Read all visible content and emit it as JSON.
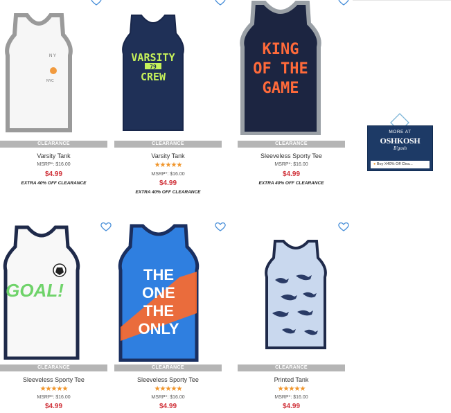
{
  "products": [
    {
      "name": "Varsity Tank",
      "badge": "CLEARANCE",
      "stars": "",
      "msrp": "MSRP*: $16.00",
      "price": "$4.99",
      "extra": "EXTRA 40% OFF CLEARANCE",
      "rating": 0,
      "shirt": {
        "body": "#f6f6f6",
        "trim": "#9a9a9a"
      }
    },
    {
      "name": "Varsity Tank",
      "badge": "CLEARANCE",
      "stars": "★★★★★",
      "msrp": "MSRP*: $16.00",
      "price": "$4.99",
      "extra": "EXTRA 40% OFF CLEARANCE",
      "rating": 5,
      "shirt": {
        "body": "#1f3057",
        "trim": "#1f3057",
        "text_lines": [
          "VARSITY",
          "79",
          "CREW"
        ],
        "text_color": "#c7f25a"
      }
    },
    {
      "name": "Sleeveless Sporty Tee",
      "badge": "CLEARANCE",
      "stars": "",
      "msrp": "MSRP*: $16.00",
      "price": "$4.99",
      "extra": "EXTRA 40% OFF CLEARANCE",
      "rating": 0,
      "shirt": {
        "body": "#1c2541",
        "trim": "#9aa0a6",
        "text_lines": [
          "KING",
          "OF THE",
          "GAME"
        ],
        "text_color": "#ff6a3a"
      }
    },
    {
      "name": "Sleeveless Sporty Tee",
      "badge": "CLEARANCE",
      "stars": "★★★★★",
      "msrp": "MSRP*: $16.00",
      "price": "$4.99",
      "extra": "",
      "rating": 5,
      "shirt": {
        "body": "#f8f8f8",
        "trim": "#1f2a4a",
        "text_lines": [
          "GOAL!"
        ],
        "text_color": "#6fd36a"
      }
    },
    {
      "name": "Sleeveless Sporty Tee",
      "badge": "CLEARANCE",
      "stars": "★★★★★",
      "msrp": "MSRP*: $16.00",
      "price": "$4.99",
      "extra": "",
      "rating": 5,
      "shirt": {
        "body": "#2f7fe0",
        "trim": "#1a2f60",
        "text_lines": [
          "THE",
          "ONE",
          "THE",
          "ONLY"
        ],
        "text_color": "#ffffff",
        "accent": "#ff6a2a"
      }
    },
    {
      "name": "Printed Tank",
      "badge": "CLEARANCE",
      "stars": "★★★★★",
      "msrp": "MSRP*: $16.00",
      "price": "$4.99",
      "extra": "",
      "rating": 5,
      "shirt": {
        "body": "#c9d8ee",
        "trim": "#1f2a4a"
      }
    }
  ],
  "ad": {
    "more_at": "MORE AT",
    "brand": "OSHKOSH",
    "sub": "B'gosh",
    "strip": "Boy X40% Off Clea...",
    "colors": {
      "panel": "#1d3a66",
      "stroke": "#7fb6d8"
    }
  },
  "colors": {
    "price": "#d0323a",
    "star": "#f0952a",
    "badge": "#b5b5b5",
    "heart": "#4a90d9"
  }
}
